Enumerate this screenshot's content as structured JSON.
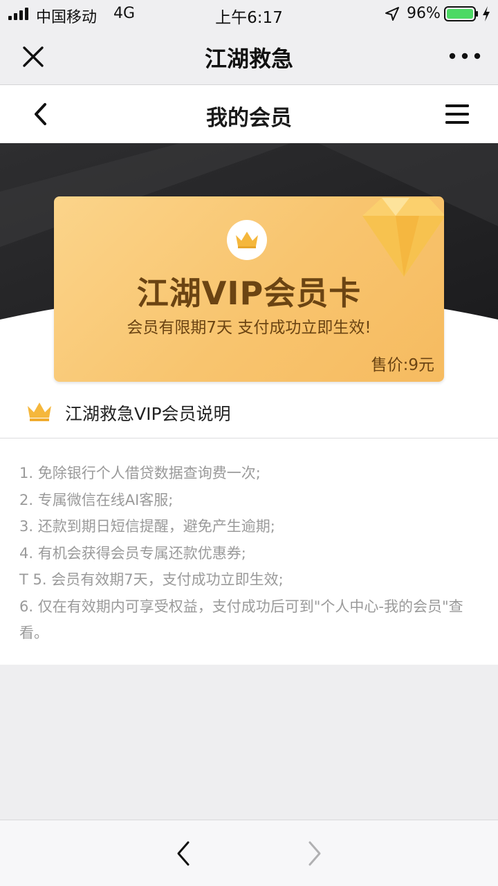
{
  "status_bar": {
    "carrier": "中国移动",
    "network": "4G",
    "time": "上午6:17",
    "battery": "96%",
    "icons": [
      "signal-icon",
      "location-arrow-icon",
      "battery-icon",
      "charging-bolt-icon"
    ],
    "battery_color": "#4cd964"
  },
  "title_bar": {
    "title": "江湖救急",
    "icons": [
      "close-icon",
      "more-icon"
    ]
  },
  "header": {
    "title": "我的会员",
    "icons": [
      "back-arrow-icon",
      "menu-icon"
    ]
  },
  "vip_card": {
    "title": "江湖VIP会员卡",
    "subtitle": "会员有限期7天 支付成功立即生效!",
    "price": "售价:9元",
    "icons": [
      "crown-icon",
      "diamond-icon"
    ],
    "card_color": "#f8c46e",
    "text_color": "#6b4413"
  },
  "description": {
    "title": "江湖救急VIP会员说明",
    "icon": "crown-icon",
    "items": [
      "1. 免除银行个人借贷数据查询费一次;",
      "2. 专属微信在线AI客服;",
      "3. 还款到期日短信提醒，避免产生逾期;",
      "4. 有机会获得会员专属还款优惠券;",
      "T 5. 会员有效期7天，支付成功立即生效;",
      "6. 仅在有效期内可享受权益，支付成功后可到\"个人中心-我的会员\"查看。"
    ]
  },
  "bottom_nav": {
    "icons": [
      "nav-back-icon",
      "nav-forward-icon"
    ]
  }
}
